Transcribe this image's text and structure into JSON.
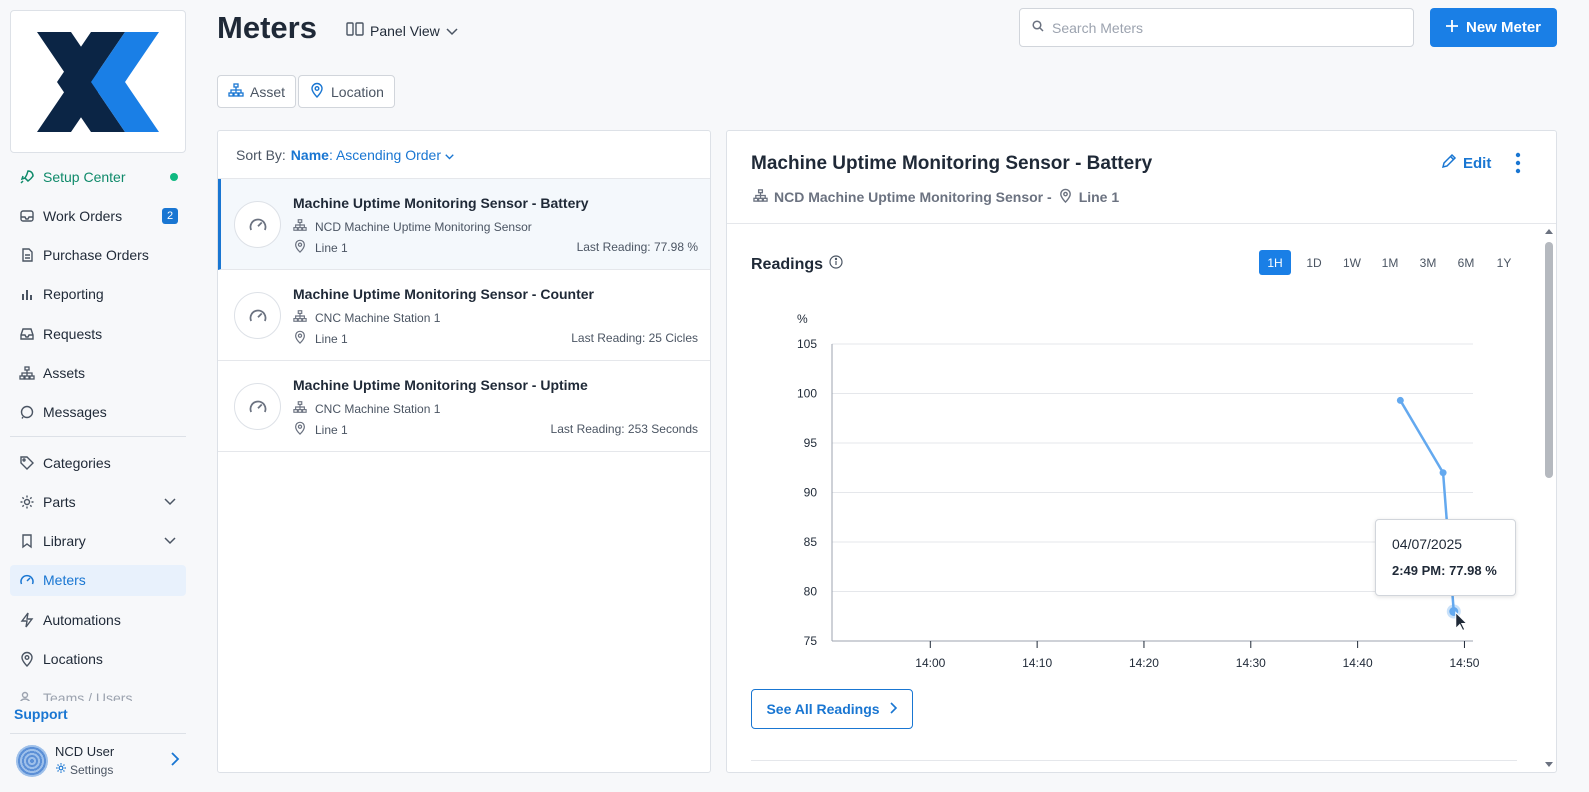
{
  "sidebar": {
    "items": [
      {
        "label": "Setup Center"
      },
      {
        "label": "Work Orders",
        "badge": "2"
      },
      {
        "label": "Purchase Orders"
      },
      {
        "label": "Reporting"
      },
      {
        "label": "Requests"
      },
      {
        "label": "Assets"
      },
      {
        "label": "Messages"
      },
      {
        "label": "Categories"
      },
      {
        "label": "Parts"
      },
      {
        "label": "Library"
      },
      {
        "label": "Meters"
      },
      {
        "label": "Automations"
      },
      {
        "label": "Locations"
      },
      {
        "label": "Teams / Users"
      }
    ],
    "support": "Support",
    "user": {
      "name": "NCD User",
      "settings": "Settings"
    }
  },
  "header": {
    "title": "Meters",
    "view_label": "Panel View",
    "search_placeholder": "Search Meters",
    "new_button": "New Meter",
    "filters": [
      "Asset",
      "Location"
    ]
  },
  "list": {
    "sort_prefix": "Sort By:",
    "sort_field": "Name",
    "sort_order": ": Ascending Order",
    "meters": [
      {
        "name": "Machine Uptime Monitoring Sensor - Battery",
        "asset": "NCD Machine Uptime Monitoring Sensor",
        "location": "Line 1",
        "last_reading": "Last Reading: 77.98 %"
      },
      {
        "name": "Machine Uptime Monitoring Sensor - Counter",
        "asset": "CNC Machine Station 1",
        "location": "Line 1",
        "last_reading": "Last Reading: 25 Cicles"
      },
      {
        "name": "Machine Uptime Monitoring Sensor - Uptime",
        "asset": "CNC Machine Station 1",
        "location": "Line 1",
        "last_reading": "Last Reading: 253 Seconds"
      }
    ]
  },
  "detail": {
    "title": "Machine Uptime Monitoring Sensor - Battery",
    "asset": "NCD Machine Uptime Monitoring Sensor -",
    "location": "Line 1",
    "edit_label": "Edit",
    "readings_title": "Readings",
    "ranges": [
      "1H",
      "1D",
      "1W",
      "1M",
      "3M",
      "6M",
      "1Y"
    ],
    "active_range": "1H",
    "see_all": "See All Readings",
    "tooltip": {
      "date": "04/07/2025",
      "value": "2:49 PM: 77.98 %"
    }
  },
  "chart_data": {
    "type": "line",
    "ylabel": "%",
    "ylim": [
      75,
      105
    ],
    "yticks": [
      75,
      80,
      85,
      90,
      95,
      100,
      105
    ],
    "xticks": [
      "14:00",
      "14:10",
      "14:20",
      "14:30",
      "14:40",
      "14:50"
    ],
    "xlim_minutes": [
      -9.2,
      50.8
    ],
    "grid": true,
    "series": [
      {
        "x_minutes": [
          44,
          48,
          49
        ],
        "values": [
          99.3,
          92.0,
          77.98
        ]
      }
    ],
    "line_color": "#64a9ef"
  },
  "colors": {
    "accent": "#1a7fe6",
    "setup": "#0f8a6a"
  }
}
